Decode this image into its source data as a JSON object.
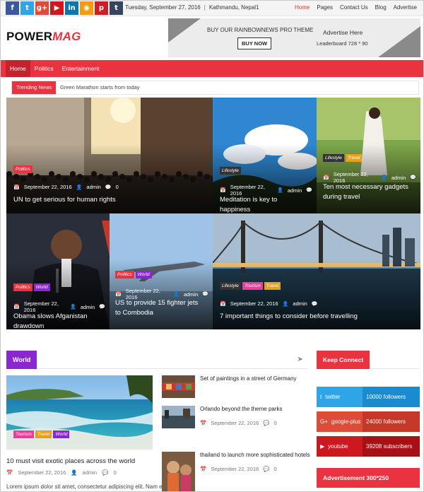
{
  "topbar": {
    "social": [
      {
        "icon": "facebook-icon",
        "glyph": "f",
        "color": "#3b5998"
      },
      {
        "icon": "twitter-icon",
        "glyph": "t",
        "color": "#2fa4e7"
      },
      {
        "icon": "google-plus-icon",
        "glyph": "g+",
        "color": "#dd4b39"
      },
      {
        "icon": "youtube-icon",
        "glyph": "▶",
        "color": "#cc181e"
      },
      {
        "icon": "linkedin-icon",
        "glyph": "in",
        "color": "#0e76a8"
      },
      {
        "icon": "rss-icon",
        "glyph": "◉",
        "color": "#f39c12"
      },
      {
        "icon": "pinterest-icon",
        "glyph": "p",
        "color": "#cb2027"
      },
      {
        "icon": "tumblr-icon",
        "glyph": "t",
        "color": "#35465c"
      }
    ],
    "date": "Tuesday, September 27, 2016",
    "location": "Kathmandu, Nepal1",
    "nav": [
      "Home",
      "Pages",
      "Contact Us",
      "Blog",
      "Advertise"
    ]
  },
  "logo": {
    "part1": "POWER",
    "part2": "MAG"
  },
  "ad_banner": {
    "line1": "BUY OUR RAINBOWNEWS PRO THEME",
    "button": "BUY NOW",
    "line2": "Advertise Here",
    "line3": "Leaderboard 728 * 90"
  },
  "main_nav": [
    "Home",
    "Politics",
    "Entertainment"
  ],
  "trending": {
    "label": "Trending News",
    "text": "Green Marathon starts from today"
  },
  "grid": [
    {
      "tags": [
        {
          "label": "Politics",
          "color": "#ea3340"
        }
      ],
      "date": "September 22, 2016",
      "author": "admin",
      "comments": "0",
      "title": "UN to get serious for human rights"
    },
    {
      "tags": [
        {
          "label": "Lifestyle",
          "color": "#333333"
        }
      ],
      "date": "September 22, 2016",
      "author": "admin",
      "comments": "",
      "title": "Meditation is key to happiness"
    },
    {
      "tags": [
        {
          "label": "Lifestyle",
          "color": "#333333"
        },
        {
          "label": "Travel",
          "color": "#e79f1f"
        }
      ],
      "date": "September 22, 2016",
      "author": "admin",
      "comments": "",
      "title": "Ten most necessary gadgets during travel"
    },
    {
      "tags": [
        {
          "label": "Politics",
          "color": "#ea3340"
        },
        {
          "label": "World",
          "color": "#8b27d1"
        }
      ],
      "date": "September 22, 2016",
      "author": "admin",
      "comments": "",
      "title": "Obama slows Afganistan drawdown"
    },
    {
      "tags": [
        {
          "label": "Politics",
          "color": "#ea3340"
        },
        {
          "label": "World",
          "color": "#8b27d1"
        }
      ],
      "date": "September 22, 2016",
      "author": "admin",
      "comments": "",
      "title": "US to provide 15 fighter jets to Combodia"
    },
    {
      "tags": [
        {
          "label": "Lifestyle",
          "color": "#333333"
        },
        {
          "label": "Tourism",
          "color": "#e8409a"
        },
        {
          "label": "Travel",
          "color": "#e79f1f"
        }
      ],
      "date": "September 22, 2016",
      "author": "admin",
      "comments": "",
      "title": "7 important things to consider before travelling"
    }
  ],
  "world": {
    "label": "World",
    "featured": {
      "tags": [
        {
          "label": "Tourism",
          "color": "#e8409a"
        },
        {
          "label": "Travel",
          "color": "#e79f1f"
        },
        {
          "label": "World",
          "color": "#8b27d1"
        }
      ],
      "title": "10 must visit exotic places across the world",
      "date": "September 22, 2016",
      "author": "admin",
      "comments": "0",
      "excerpt": "Lorem ipsum dolor sit amet, consectetur adipiscing elit. Nam eget ea"
    },
    "list": [
      {
        "title": "Set of paintings in a street of Germany",
        "date": "",
        "comments": ""
      },
      {
        "title": "Orlando beyond the theme parks",
        "date": "September 22, 2016",
        "comments": "0"
      },
      {
        "title": "thailand to launch more sophisticated hotels",
        "date": "September 22, 2016",
        "comments": "0"
      }
    ]
  },
  "keep_connect": {
    "label": "Keep Connect",
    "rows": [
      {
        "icon": "twitter-icon",
        "name": "twitter",
        "count": "10000 followers",
        "color": "#2fa4e7",
        "dark": "#1b8bd0"
      },
      {
        "icon": "google-plus-icon",
        "name": "google-plus",
        "count": "24000 followers",
        "color": "#dd4b39",
        "dark": "#c53727"
      },
      {
        "icon": "youtube-icon",
        "name": "youtube",
        "count": "39208 subscribers",
        "color": "#cc181e",
        "dark": "#a81015"
      }
    ]
  },
  "advertisement": "Advertisement 300*250"
}
